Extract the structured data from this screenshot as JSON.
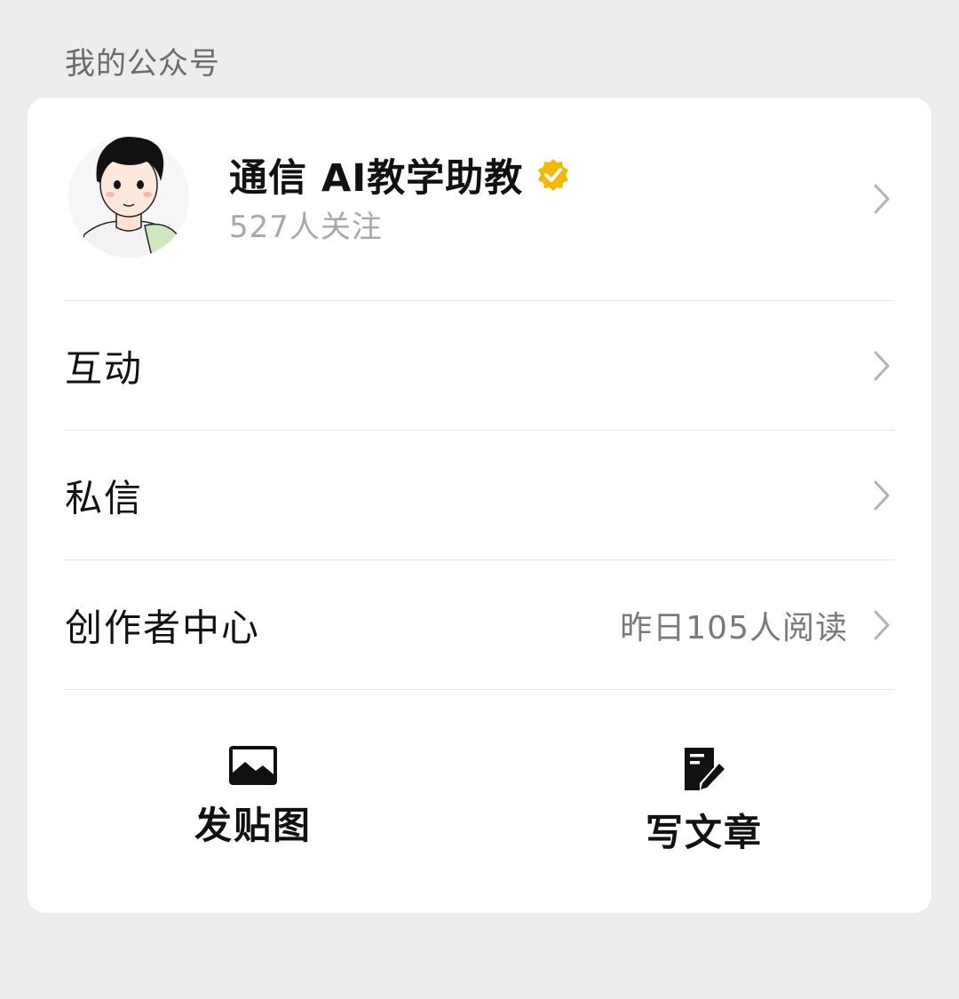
{
  "section_title": "我的公众号",
  "account": {
    "name": "通信 AI教学助教",
    "followers": "527人关注",
    "avatar_icon": "cartoon-boy-avatar",
    "verified_icon": "verified-badge-icon",
    "verified_color": "#f5b800"
  },
  "menu": [
    {
      "label": "互动",
      "value": ""
    },
    {
      "label": "私信",
      "value": ""
    },
    {
      "label": "创作者中心",
      "value": "昨日105人阅读"
    }
  ],
  "actions": [
    {
      "label": "发贴图",
      "icon": "image-icon"
    },
    {
      "label": "写文章",
      "icon": "write-article-icon"
    }
  ],
  "colors": {
    "background": "#ededed",
    "card": "#ffffff",
    "text": "#111111",
    "secondary_text": "#a8a8a8",
    "chevron": "#b3b3b3"
  }
}
